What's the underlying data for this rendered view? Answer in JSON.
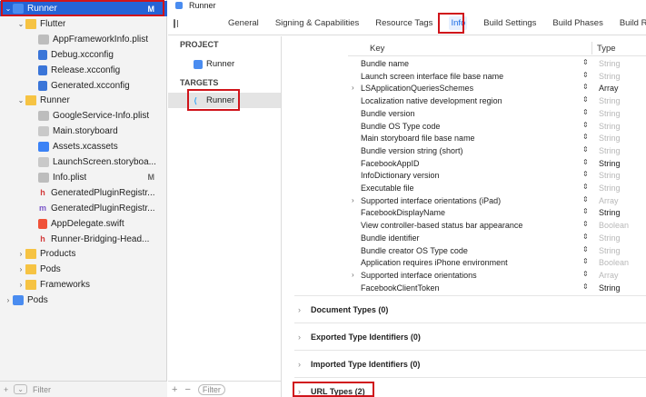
{
  "navigator": {
    "rows": [
      {
        "label": "Runner",
        "badge": "M",
        "icon": "project-icon",
        "chevron": "⌄",
        "indent": 0,
        "kind": "proj",
        "selected": true
      },
      {
        "label": "Flutter",
        "badge": "",
        "icon": "folder-icon",
        "chevron": "⌄",
        "indent": 1,
        "kind": "folder"
      },
      {
        "label": "AppFrameworkInfo.plist",
        "badge": "",
        "icon": "plist-file-icon",
        "chevron": "",
        "indent": 2,
        "kind": "plist"
      },
      {
        "label": "Debug.xcconfig",
        "badge": "",
        "icon": "xcconfig-file-icon",
        "chevron": "",
        "indent": 2,
        "kind": "xcconfig"
      },
      {
        "label": "Release.xcconfig",
        "badge": "",
        "icon": "xcconfig-file-icon",
        "chevron": "",
        "indent": 2,
        "kind": "xcconfig"
      },
      {
        "label": "Generated.xcconfig",
        "badge": "",
        "icon": "xcconfig-file-icon",
        "chevron": "",
        "indent": 2,
        "kind": "xcconfig"
      },
      {
        "label": "Runner",
        "badge": "",
        "icon": "folder-icon",
        "chevron": "⌄",
        "indent": 1,
        "kind": "folder"
      },
      {
        "label": "GoogleService-Info.plist",
        "badge": "",
        "icon": "plist-file-icon",
        "chevron": "",
        "indent": 2,
        "kind": "plist"
      },
      {
        "label": "Main.storyboard",
        "badge": "",
        "icon": "storyboard-file-icon",
        "chevron": "",
        "indent": 2,
        "kind": "story"
      },
      {
        "label": "Assets.xcassets",
        "badge": "",
        "icon": "assets-folder-icon",
        "chevron": "",
        "indent": 2,
        "kind": "assets"
      },
      {
        "label": "LaunchScreen.storyboa...",
        "badge": "",
        "icon": "storyboard-file-icon",
        "chevron": "",
        "indent": 2,
        "kind": "story"
      },
      {
        "label": "Info.plist",
        "badge": "M",
        "icon": "plist-file-icon",
        "chevron": "",
        "indent": 2,
        "kind": "plist"
      },
      {
        "label": "GeneratedPluginRegistr...",
        "badge": "",
        "icon": "header-file-icon",
        "chevron": "",
        "indent": 2,
        "kind": "h"
      },
      {
        "label": "GeneratedPluginRegistr...",
        "badge": "",
        "icon": "objc-file-icon",
        "chevron": "",
        "indent": 2,
        "kind": "m"
      },
      {
        "label": "AppDelegate.swift",
        "badge": "",
        "icon": "swift-file-icon",
        "chevron": "",
        "indent": 2,
        "kind": "swift"
      },
      {
        "label": "Runner-Bridging-Head...",
        "badge": "",
        "icon": "header-file-icon",
        "chevron": "",
        "indent": 2,
        "kind": "h"
      },
      {
        "label": "Products",
        "badge": "",
        "icon": "folder-icon",
        "chevron": "›",
        "indent": 1,
        "kind": "folder"
      },
      {
        "label": "Pods",
        "badge": "",
        "icon": "folder-icon",
        "chevron": "›",
        "indent": 1,
        "kind": "folder"
      },
      {
        "label": "Frameworks",
        "badge": "",
        "icon": "folder-icon",
        "chevron": "›",
        "indent": 1,
        "kind": "folder"
      },
      {
        "label": "Pods",
        "badge": "",
        "icon": "project-icon",
        "chevron": "›",
        "indent": 0,
        "kind": "proj"
      }
    ],
    "filter_placeholder": "Filter",
    "add_label": "+"
  },
  "editor": {
    "title": "Runner",
    "tabs": [
      "General",
      "Signing & Capabilities",
      "Resource Tags",
      "Info",
      "Build Settings",
      "Build Phases",
      "Build Rules"
    ],
    "active_tab": "Info"
  },
  "targets_panel": {
    "project_heading": "PROJECT",
    "project_item": "Runner",
    "targets_heading": "TARGETS",
    "target_item": "Runner",
    "filter_placeholder": "Filter",
    "add_label": "+",
    "remove_label": "−"
  },
  "plist": {
    "key_header": "Key",
    "type_header": "Type",
    "rows": [
      {
        "key": "Bundle name",
        "type": "String",
        "dim": true,
        "expandable": false
      },
      {
        "key": "Launch screen interface file base name",
        "type": "String",
        "dim": true,
        "expandable": false
      },
      {
        "key": "LSApplicationQueriesSchemes",
        "type": "Array",
        "dim": false,
        "expandable": true
      },
      {
        "key": "Localization native development region",
        "type": "String",
        "dim": true,
        "expandable": false
      },
      {
        "key": "Bundle version",
        "type": "String",
        "dim": true,
        "expandable": false
      },
      {
        "key": "Bundle OS Type code",
        "type": "String",
        "dim": true,
        "expandable": false
      },
      {
        "key": "Main storyboard file base name",
        "type": "String",
        "dim": true,
        "expandable": false
      },
      {
        "key": "Bundle version string (short)",
        "type": "String",
        "dim": true,
        "expandable": false
      },
      {
        "key": "FacebookAppID",
        "type": "String",
        "dim": false,
        "expandable": false
      },
      {
        "key": "InfoDictionary version",
        "type": "String",
        "dim": true,
        "expandable": false
      },
      {
        "key": "Executable file",
        "type": "String",
        "dim": true,
        "expandable": false
      },
      {
        "key": "Supported interface orientations (iPad)",
        "type": "Array",
        "dim": true,
        "expandable": true
      },
      {
        "key": "FacebookDisplayName",
        "type": "String",
        "dim": false,
        "expandable": false
      },
      {
        "key": "View controller-based status bar appearance",
        "type": "Boolean",
        "dim": true,
        "expandable": false
      },
      {
        "key": "Bundle identifier",
        "type": "String",
        "dim": true,
        "expandable": false
      },
      {
        "key": "Bundle creator OS Type code",
        "type": "String",
        "dim": true,
        "expandable": false
      },
      {
        "key": "Application requires iPhone environment",
        "type": "Boolean",
        "dim": true,
        "expandable": false
      },
      {
        "key": "Supported interface orientations",
        "type": "Array",
        "dim": true,
        "expandable": true
      },
      {
        "key": "FacebookClientToken",
        "type": "String",
        "dim": false,
        "expandable": false
      }
    ]
  },
  "sections": [
    {
      "label": "Document Types (0)"
    },
    {
      "label": "Exported Type Identifiers (0)"
    },
    {
      "label": "Imported Type Identifiers (0)"
    },
    {
      "label": "URL Types (2)"
    }
  ],
  "colors": {
    "selection": "#2563d6",
    "annotation_red": "#d0141b",
    "active_tab": "#1f6fe5"
  }
}
